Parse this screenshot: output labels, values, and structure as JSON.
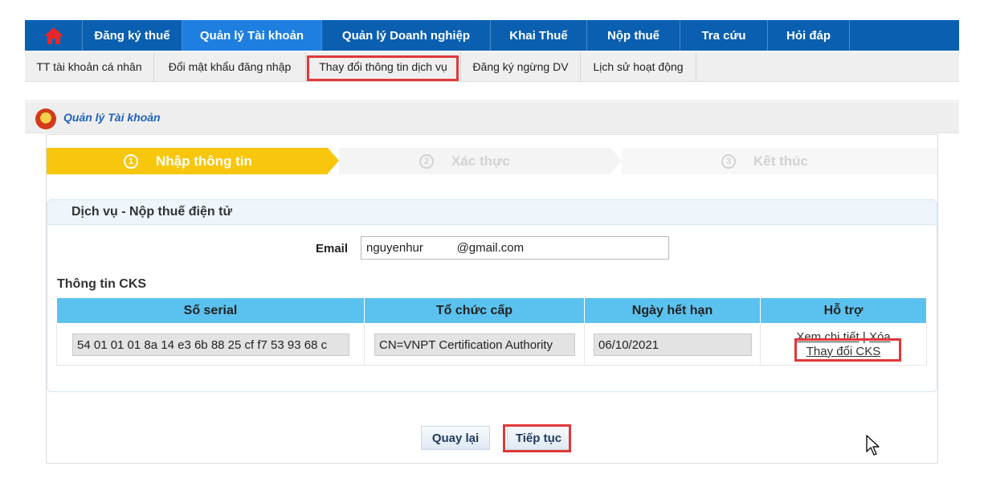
{
  "topnav": {
    "items": [
      {
        "label": "Đăng ký thuế"
      },
      {
        "label": "Quản lý Tài khoản"
      },
      {
        "label": "Quản lý Doanh nghiệp"
      },
      {
        "label": "Khai Thuế"
      },
      {
        "label": "Nộp thuế"
      },
      {
        "label": "Tra cứu"
      },
      {
        "label": "Hỏi đáp"
      }
    ]
  },
  "subnav": {
    "items": [
      {
        "label": "TT tài khoản cá nhân"
      },
      {
        "label": "Đổi mật khẩu đăng nhập"
      },
      {
        "label": "Thay đổi thông tin dịch vụ"
      },
      {
        "label": "Đăng ký ngừng DV"
      },
      {
        "label": "Lịch sử hoạt động"
      }
    ]
  },
  "section": {
    "title": "Quản lý Tài khoản"
  },
  "steps": [
    {
      "num": "1",
      "label": "Nhập thông tin"
    },
    {
      "num": "2",
      "label": "Xác thực"
    },
    {
      "num": "3",
      "label": "Kết thúc"
    }
  ],
  "service": {
    "title": "Dịch vụ - Nộp thuế điện tử",
    "email_label": "Email",
    "email_value": "nguyenhur          @gmail.com"
  },
  "cks": {
    "title": "Thông tin CKS",
    "headers": [
      "Số serial",
      "Tổ chức cấp",
      "Ngày hết hạn",
      "Hỗ trợ"
    ],
    "row": {
      "serial": "54 01 01 01 8a 14 e3 6b 88 25 cf f7 53 93 68 c",
      "issuer": "CN=VNPT Certification Authority",
      "expiry": "06/10/2021",
      "view_link": "Xem chi tiết",
      "separator": "|",
      "delete_link": "Xóa",
      "change_link": "Thay đổi CKS"
    }
  },
  "buttons": {
    "back": "Quay lại",
    "next": "Tiếp tục"
  },
  "colors": {
    "nav_bg": "#0a5fb0",
    "nav_active": "#1e7fe0",
    "step_active": "#f8c60c",
    "table_header": "#5bc2ef",
    "highlight": "#e0383a"
  }
}
